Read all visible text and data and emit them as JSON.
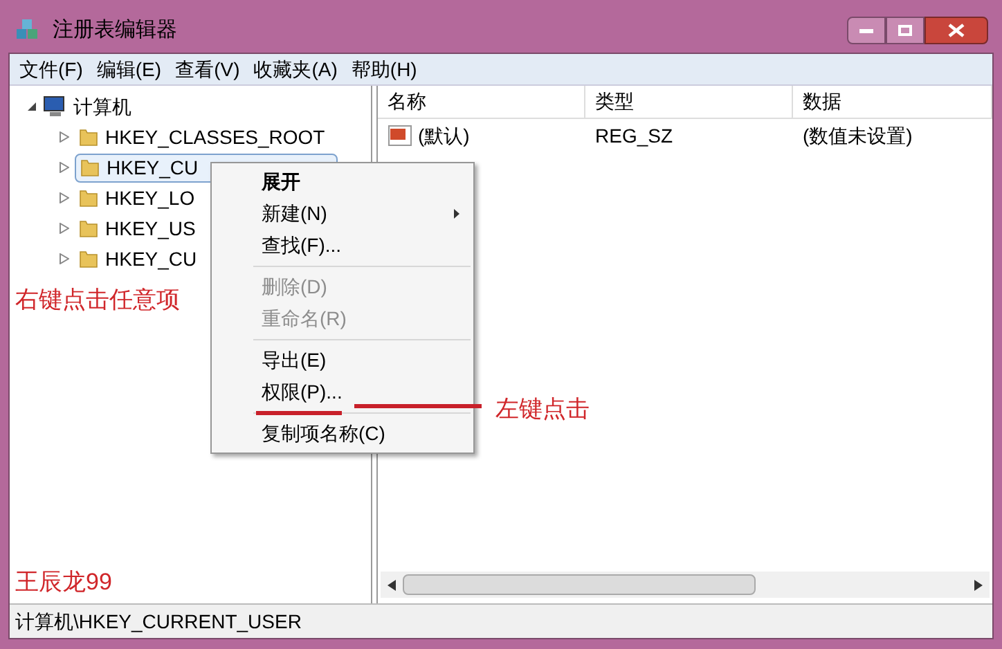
{
  "window": {
    "title": "注册表编辑器"
  },
  "menu_bar": [
    "文件(F)",
    "编辑(E)",
    "查看(V)",
    "收藏夹(A)",
    "帮助(H)"
  ],
  "tree": {
    "label": "计算机",
    "expanded": true,
    "children": [
      {
        "label": "HKEY_CLASSES_ROOT",
        "selected": false
      },
      {
        "label": "HKEY_CU",
        "selected": true
      },
      {
        "label": "HKEY_LO",
        "selected": false
      },
      {
        "label": "HKEY_US",
        "selected": false
      },
      {
        "label": "HKEY_CU",
        "selected": false
      }
    ]
  },
  "table": {
    "columns": [
      "名称",
      "类型",
      "数据"
    ],
    "rows": [
      [
        "(默认)",
        "REG_SZ",
        "(数值未设置)"
      ]
    ]
  },
  "context_menu": [
    {
      "kind": "item",
      "label": "展开",
      "bold": true,
      "disabled": false
    },
    {
      "kind": "submenu",
      "label": "新建(N)",
      "bold": false,
      "disabled": false
    },
    {
      "kind": "item",
      "label": "查找(F)...",
      "bold": false,
      "disabled": false
    },
    {
      "kind": "separator"
    },
    {
      "kind": "item",
      "label": "删除(D)",
      "bold": false,
      "disabled": true
    },
    {
      "kind": "item",
      "label": "重命名(R)",
      "bold": false,
      "disabled": true
    },
    {
      "kind": "separator"
    },
    {
      "kind": "item",
      "label": "导出(E)",
      "bold": false,
      "disabled": false
    },
    {
      "kind": "item",
      "label": "权限(P)...",
      "bold": false,
      "disabled": false
    },
    {
      "kind": "separator"
    },
    {
      "kind": "item",
      "label": "复制项名称(C)",
      "bold": false,
      "disabled": false
    }
  ],
  "annotations": {
    "right_click": "右键点击任意项",
    "left_click": "左键点击",
    "author": "王辰龙99"
  },
  "status_bar": "计算机\\HKEY_CURRENT_USER"
}
